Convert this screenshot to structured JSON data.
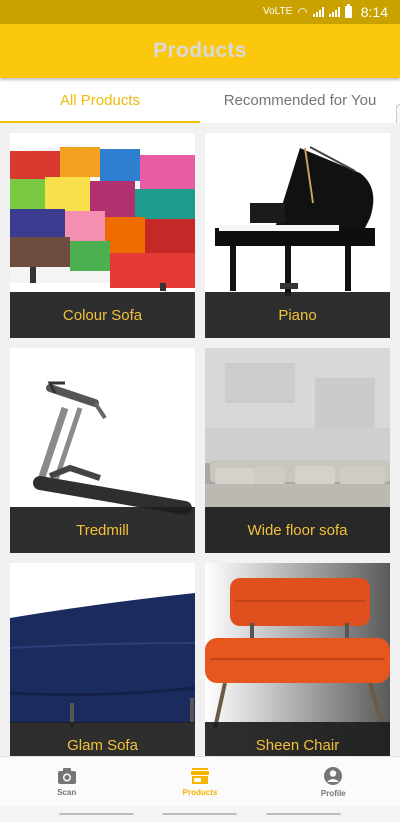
{
  "status_bar": {
    "time": "8:14",
    "network_label": "VoLTE"
  },
  "app_bar": {
    "title": "Products"
  },
  "tabs": [
    {
      "label": "All Products",
      "active": true
    },
    {
      "label": "Recommended for You",
      "active": false
    }
  ],
  "products": [
    {
      "name": "Colour Sofa",
      "image_icon": "colour-sofa-image"
    },
    {
      "name": "Piano",
      "image_icon": "piano-image"
    },
    {
      "name": "Tredmill",
      "image_icon": "treadmill-image"
    },
    {
      "name": "Wide floor sofa",
      "image_icon": "wide-floor-sofa-image"
    },
    {
      "name": "Glam Sofa",
      "image_icon": "glam-sofa-image"
    },
    {
      "name": "Sheen Chair",
      "image_icon": "sheen-chair-image"
    }
  ],
  "bottom_nav": [
    {
      "label": "Scan",
      "icon": "camera-icon",
      "active": false
    },
    {
      "label": "Products",
      "icon": "store-icon",
      "active": true
    },
    {
      "label": "Profile",
      "icon": "account-circle-icon",
      "active": false
    }
  ],
  "colors": {
    "primary": "#fcc80e",
    "status_bar": "#c9a200",
    "accent_text": "#f0b90b",
    "caption_text": "#f2c13a"
  }
}
